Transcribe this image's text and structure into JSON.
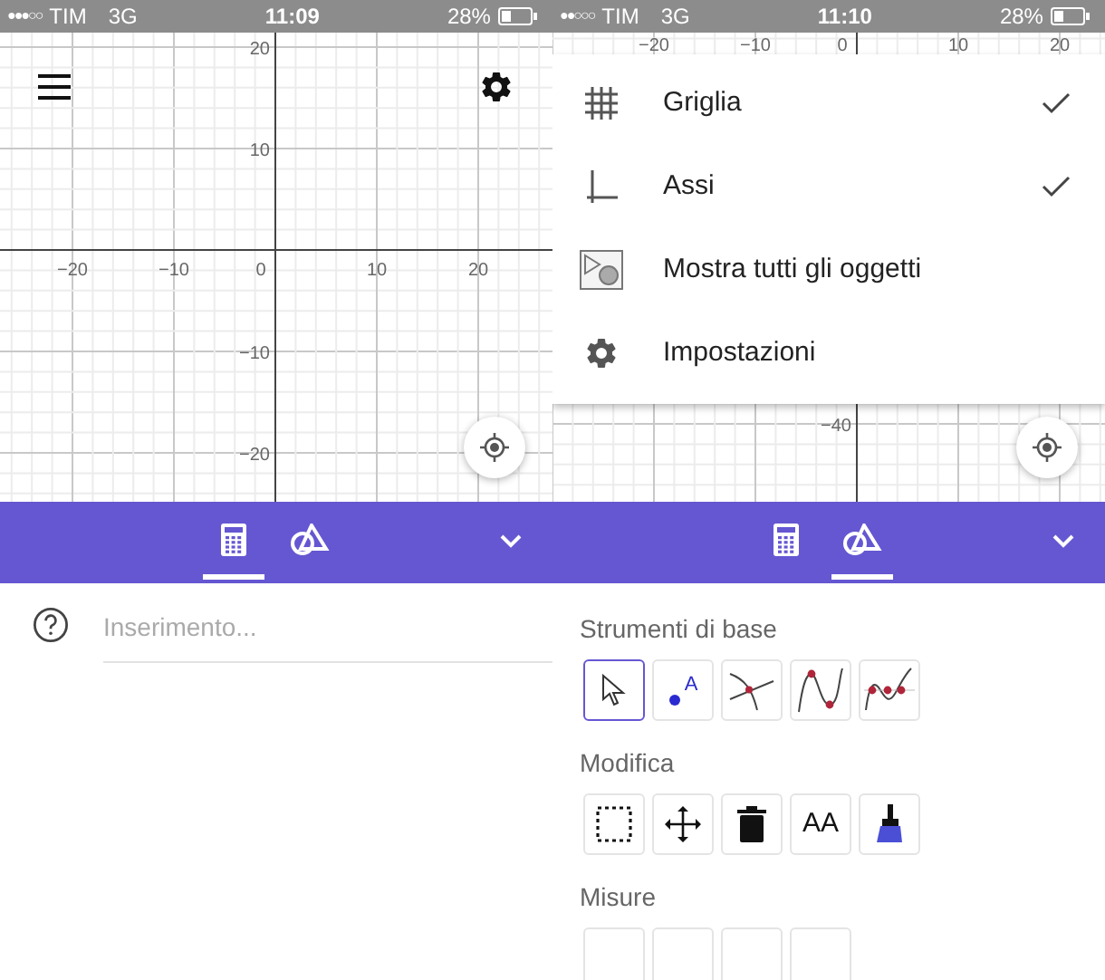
{
  "screens": [
    {
      "status_bar": {
        "signal": "●●●○○",
        "carrier": "TIM",
        "network": "3G",
        "time": "11:09",
        "battery": "28%"
      },
      "graph": {
        "x_labels": [
          "−20",
          "−10",
          "0",
          "10",
          "20"
        ],
        "y_labels": [
          "20",
          "10",
          "−10",
          "−20"
        ]
      },
      "tabs": [
        {
          "kind": "calculator",
          "selected": true
        },
        {
          "kind": "geometry",
          "selected": false
        }
      ],
      "input": {
        "placeholder": "Inserimento..."
      }
    },
    {
      "status_bar": {
        "signal": "●●○○○",
        "carrier": "TIM",
        "network": "3G",
        "time": "11:10",
        "battery": "28%"
      },
      "graph": {
        "x_labels": [
          "−20",
          "−10",
          "0",
          "10",
          "20"
        ],
        "y_labels": [
          "−40"
        ]
      },
      "menu": [
        {
          "kind": "grid",
          "label": "Griglia",
          "checked": true
        },
        {
          "kind": "axes",
          "label": "Assi",
          "checked": true
        },
        {
          "kind": "objects",
          "label": "Mostra tutti gli oggetti",
          "checked": false
        },
        {
          "kind": "settings",
          "label": "Impostazioni",
          "checked": false
        }
      ],
      "tabs": [
        {
          "kind": "calculator",
          "selected": false
        },
        {
          "kind": "geometry",
          "selected": true
        }
      ],
      "tool_sections": [
        {
          "title": "Strumenti di base",
          "tools": [
            {
              "kind": "move",
              "selected": true
            },
            {
              "kind": "point",
              "label": "A",
              "selected": false
            },
            {
              "kind": "intersect",
              "selected": false
            },
            {
              "kind": "extremum",
              "selected": false
            },
            {
              "kind": "roots",
              "selected": false
            }
          ]
        },
        {
          "title": "Modifica",
          "tools": [
            {
              "kind": "select",
              "selected": false
            },
            {
              "kind": "translate",
              "selected": false
            },
            {
              "kind": "delete",
              "selected": false
            },
            {
              "kind": "text",
              "label": "AA",
              "selected": false
            },
            {
              "kind": "style",
              "selected": false
            }
          ]
        },
        {
          "title": "Misure",
          "tools": [
            {
              "kind": "partial",
              "selected": false
            },
            {
              "kind": "partial",
              "selected": false
            },
            {
              "kind": "partial",
              "selected": false
            },
            {
              "kind": "partial",
              "selected": false
            }
          ]
        }
      ]
    }
  ]
}
